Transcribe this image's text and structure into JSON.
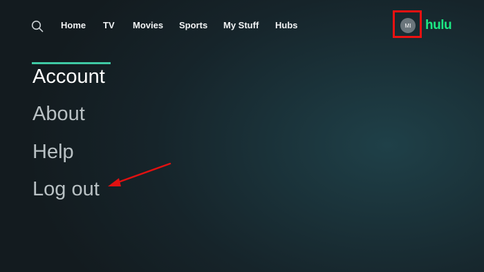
{
  "nav": {
    "items": [
      {
        "label": "Home"
      },
      {
        "label": "TV"
      },
      {
        "label": "Movies"
      },
      {
        "label": "Sports"
      },
      {
        "label": "My Stuff"
      },
      {
        "label": "Hubs"
      }
    ],
    "avatar_initials": "MI",
    "brand": "hulu"
  },
  "menu": {
    "items": [
      {
        "label": "Account",
        "active": true
      },
      {
        "label": "About",
        "active": false
      },
      {
        "label": "Help",
        "active": false
      },
      {
        "label": "Log out",
        "active": false
      }
    ]
  },
  "icons": {
    "search": "search-icon",
    "annotation_arrow": "red-arrow-icon"
  },
  "colors": {
    "accent": "#1ce783",
    "active_bar": "#3fc9a4",
    "annotation": "#e11111",
    "menu_active_text": "#ffffff",
    "menu_inactive_text": "#b9c1c4"
  }
}
